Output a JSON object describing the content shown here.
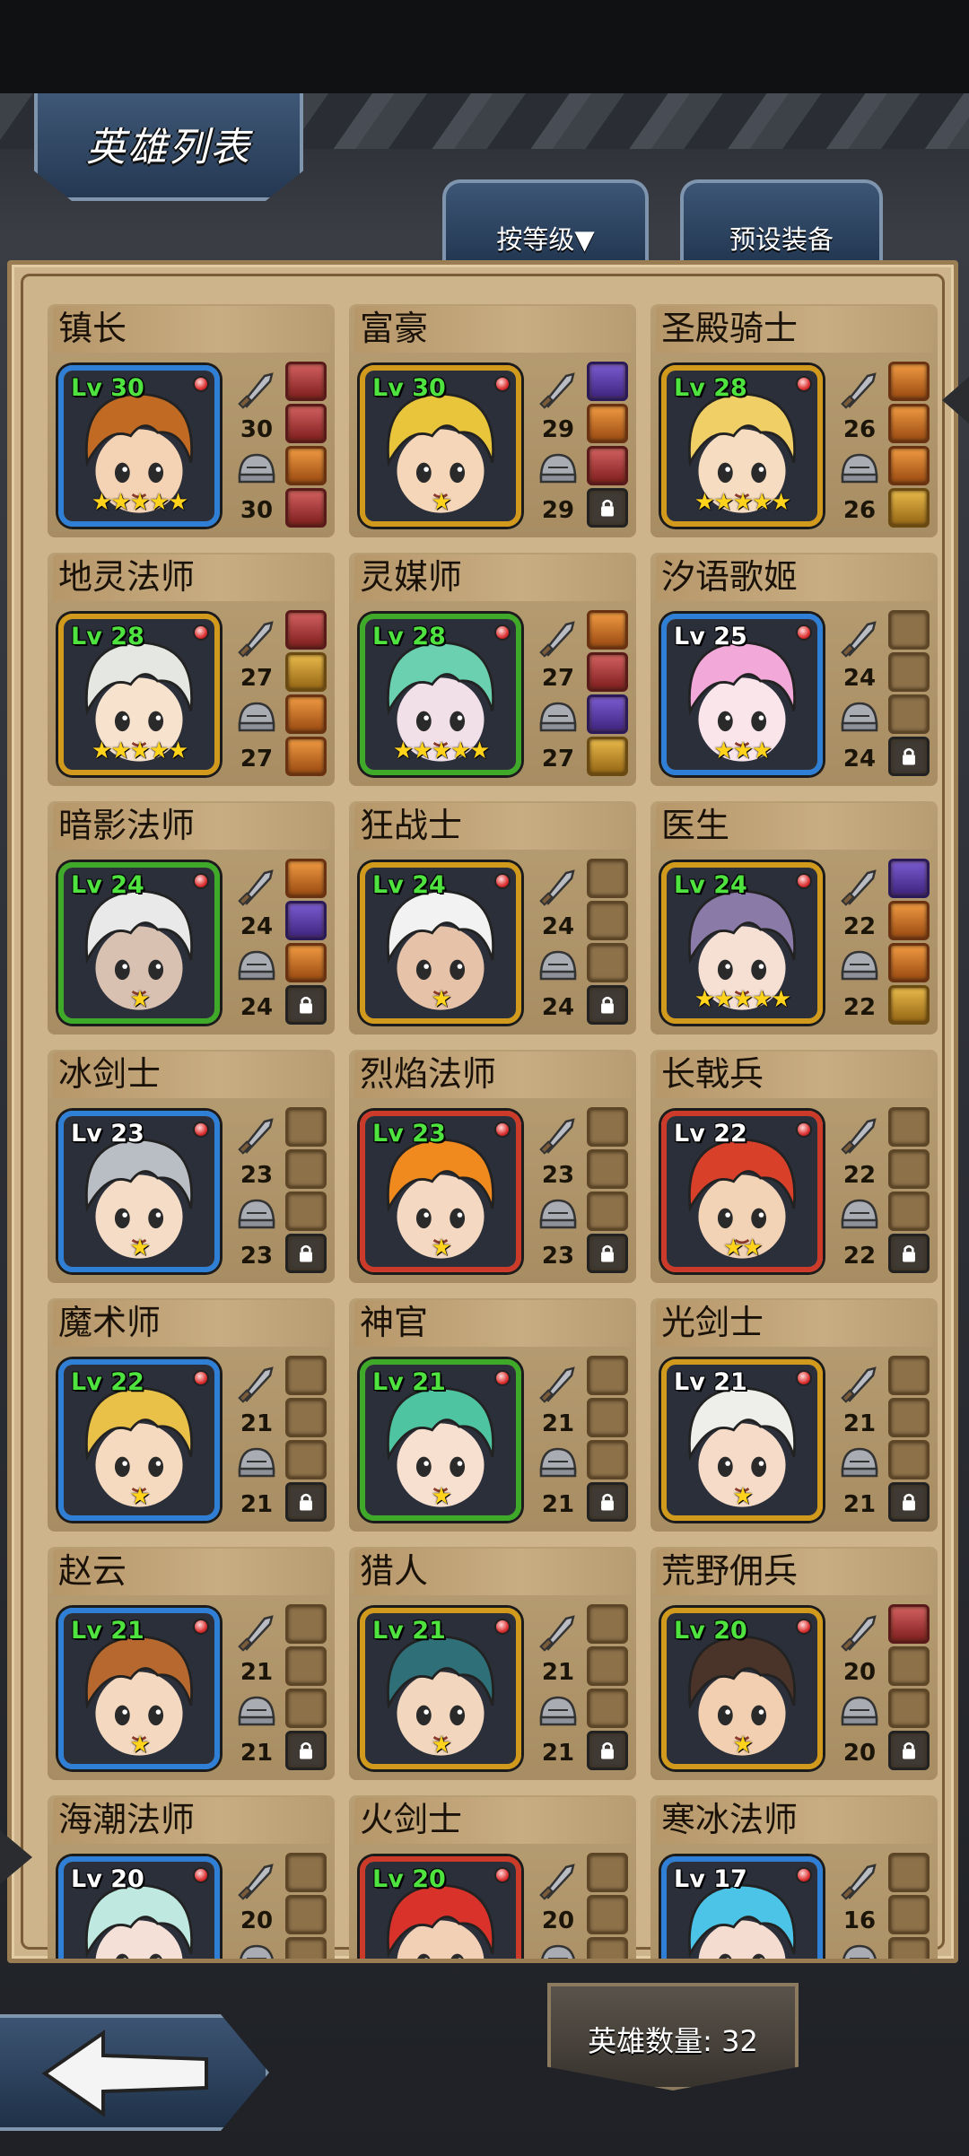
{
  "header": {
    "title": "英雄列表"
  },
  "tabs": {
    "sort_label": "按等级▼",
    "preset_label": "预设装备"
  },
  "heroes": [
    {
      "name": "镇长",
      "level": "Lv 30",
      "stars": "★★★★★",
      "weapon": "30",
      "armor": "30",
      "frame": "blue",
      "lv_color": "green",
      "hair": "#c06a24",
      "skin": "#f4d3b5",
      "slots": [
        "item",
        "item",
        "item orange",
        "item"
      ]
    },
    {
      "name": "富豪",
      "level": "Lv 30",
      "stars": "★",
      "weapon": "29",
      "armor": "29",
      "frame": "gold",
      "lv_color": "green",
      "hair": "#e8c53a",
      "skin": "#f5d6b8",
      "slots": [
        "item purple",
        "item orange",
        "item",
        "lock"
      ]
    },
    {
      "name": "圣殿骑士",
      "level": "Lv 28",
      "stars": "★★★★★",
      "weapon": "26",
      "armor": "26",
      "frame": "gold",
      "lv_color": "green",
      "hair": "#f0cf67",
      "skin": "#f6dcc0",
      "slots": [
        "item orange",
        "item orange",
        "item orange",
        "item gold"
      ]
    },
    {
      "name": "地灵法师",
      "level": "Lv 28",
      "stars": "★★★★★",
      "weapon": "27",
      "armor": "27",
      "frame": "gold",
      "lv_color": "green",
      "hair": "#e5e8e2",
      "skin": "#f7e2ce",
      "slots": [
        "item",
        "item gold",
        "item orange",
        "item orange"
      ]
    },
    {
      "name": "灵媒师",
      "level": "Lv 28",
      "stars": "★★★★★",
      "weapon": "27",
      "armor": "27",
      "frame": "green",
      "lv_color": "green",
      "hair": "#6ad0b0",
      "skin": "#f2e0e8",
      "slots": [
        "item orange",
        "item",
        "item purple",
        "item gold"
      ]
    },
    {
      "name": "汐语歌姬",
      "level": "Lv 25",
      "stars": "★★★",
      "weapon": "24",
      "armor": "24",
      "frame": "blue",
      "lv_color": "white",
      "hair": "#f2a8d8",
      "skin": "#fae6ea",
      "slots": [
        "empty",
        "empty",
        "empty",
        "lock"
      ]
    },
    {
      "name": "暗影法师",
      "level": "Lv 24",
      "stars": "★",
      "weapon": "24",
      "armor": "24",
      "frame": "green",
      "lv_color": "green",
      "hair": "#e9e9e9",
      "skin": "#d9c1b2",
      "slots": [
        "item orange",
        "item purple",
        "item orange",
        "lock"
      ]
    },
    {
      "name": "狂战士",
      "level": "Lv 24",
      "stars": "★",
      "weapon": "24",
      "armor": "24",
      "frame": "gold",
      "lv_color": "green",
      "hair": "#f2f2f2",
      "skin": "#e6c2a8",
      "slots": [
        "empty",
        "empty",
        "empty",
        "lock"
      ]
    },
    {
      "name": "医生",
      "level": "Lv 24",
      "stars": "★★★★★",
      "weapon": "22",
      "armor": "22",
      "frame": "gold",
      "lv_color": "green",
      "hair": "#8a7aa8",
      "skin": "#f6e0d4",
      "slots": [
        "item purple",
        "item orange",
        "item orange",
        "item gold"
      ]
    },
    {
      "name": "冰剑士",
      "level": "Lv 23",
      "stars": "★",
      "weapon": "23",
      "armor": "23",
      "frame": "blue",
      "lv_color": "white",
      "hair": "#b9bec4",
      "skin": "#f4dcc6",
      "slots": [
        "empty",
        "empty",
        "empty",
        "lock"
      ]
    },
    {
      "name": "烈焰法师",
      "level": "Lv 23",
      "stars": "★",
      "weapon": "23",
      "armor": "23",
      "frame": "red",
      "lv_color": "green",
      "hair": "#f08a1e",
      "skin": "#f4d8c2",
      "slots": [
        "empty",
        "empty",
        "empty",
        "lock"
      ]
    },
    {
      "name": "长戟兵",
      "level": "Lv 22",
      "stars": "★★",
      "weapon": "22",
      "armor": "22",
      "frame": "red",
      "lv_color": "white",
      "hair": "#d8402a",
      "skin": "#f3d3b6",
      "slots": [
        "empty",
        "empty",
        "empty",
        "lock"
      ]
    },
    {
      "name": "魔术师",
      "level": "Lv 22",
      "stars": "★",
      "weapon": "21",
      "armor": "21",
      "frame": "blue",
      "lv_color": "green",
      "hair": "#e9c048",
      "skin": "#f5dac0",
      "slots": [
        "empty",
        "empty",
        "empty",
        "lock"
      ]
    },
    {
      "name": "神官",
      "level": "Lv 21",
      "stars": "★",
      "weapon": "21",
      "armor": "21",
      "frame": "green",
      "lv_color": "green",
      "hair": "#4fc4a0",
      "skin": "#f7e0cf",
      "slots": [
        "empty",
        "empty",
        "empty",
        "lock"
      ]
    },
    {
      "name": "光剑士",
      "level": "Lv 21",
      "stars": "★",
      "weapon": "21",
      "armor": "21",
      "frame": "gold",
      "lv_color": "white",
      "hair": "#eeeeea",
      "skin": "#f6dcc8",
      "slots": [
        "empty",
        "empty",
        "empty",
        "lock"
      ]
    },
    {
      "name": "赵云",
      "level": "Lv 21",
      "stars": "★",
      "weapon": "21",
      "armor": "21",
      "frame": "blue",
      "lv_color": "green",
      "hair": "#b7682e",
      "skin": "#f4d8bf",
      "slots": [
        "empty",
        "empty",
        "empty",
        "lock"
      ]
    },
    {
      "name": "猎人",
      "level": "Lv 21",
      "stars": "★",
      "weapon": "21",
      "armor": "21",
      "frame": "gold",
      "lv_color": "green",
      "hair": "#2f6f78",
      "skin": "#f2d6be",
      "slots": [
        "empty",
        "empty",
        "empty",
        "lock"
      ]
    },
    {
      "name": "荒野佣兵",
      "level": "Lv 20",
      "stars": "★",
      "weapon": "20",
      "armor": "20",
      "frame": "gold",
      "lv_color": "green",
      "hair": "#4a3328",
      "skin": "#f1cfb0",
      "slots": [
        "item",
        "empty",
        "empty",
        "lock"
      ]
    },
    {
      "name": "海潮法师",
      "level": "Lv 20",
      "stars": "",
      "weapon": "20",
      "armor": "",
      "frame": "blue",
      "lv_color": "white",
      "hair": "#bfe8e0",
      "skin": "#f4e0d6",
      "slots": [
        "empty",
        "empty",
        "empty",
        "empty"
      ]
    },
    {
      "name": "火剑士",
      "level": "Lv 20",
      "stars": "",
      "weapon": "20",
      "armor": "",
      "frame": "red",
      "lv_color": "green",
      "hair": "#d8322a",
      "skin": "#f2d0b6",
      "slots": [
        "empty",
        "empty",
        "empty",
        "empty"
      ]
    },
    {
      "name": "寒冰法师",
      "level": "Lv 17",
      "stars": "",
      "weapon": "16",
      "armor": "",
      "frame": "blue",
      "lv_color": "white",
      "hair": "#4cc4e8",
      "skin": "#f4dcd0",
      "slots": [
        "empty",
        "empty",
        "empty",
        "empty"
      ]
    }
  ],
  "footer": {
    "hero_count_label": "英雄数量: 32"
  }
}
